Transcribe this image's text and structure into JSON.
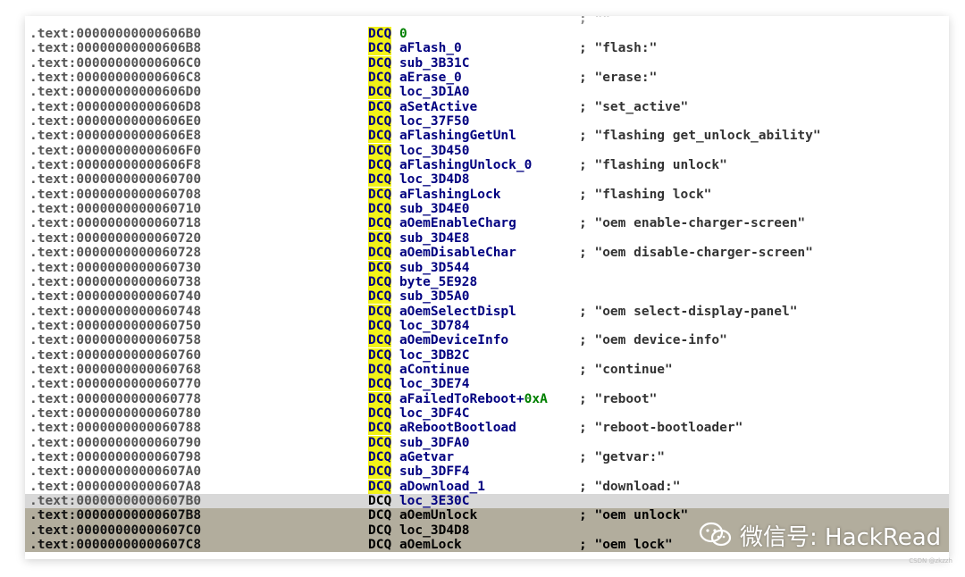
{
  "top_comment": "; \"\"",
  "rows": [
    {
      "addr": ".text:00000000000606B0",
      "kw": "DCQ",
      "op": "",
      "num": "0",
      "cmt": "",
      "hl": ""
    },
    {
      "addr": ".text:00000000000606B8",
      "kw": "DCQ",
      "op": "aFlash_0",
      "num": "",
      "cmt": "; \"flash:\"",
      "hl": ""
    },
    {
      "addr": ".text:00000000000606C0",
      "kw": "DCQ",
      "op": "sub_3B31C",
      "num": "",
      "cmt": "",
      "hl": ""
    },
    {
      "addr": ".text:00000000000606C8",
      "kw": "DCQ",
      "op": "aErase_0",
      "num": "",
      "cmt": "; \"erase:\"",
      "hl": ""
    },
    {
      "addr": ".text:00000000000606D0",
      "kw": "DCQ",
      "op": "loc_3D1A0",
      "num": "",
      "cmt": "",
      "hl": ""
    },
    {
      "addr": ".text:00000000000606D8",
      "kw": "DCQ",
      "op": "aSetActive",
      "num": "",
      "cmt": "; \"set_active\"",
      "hl": ""
    },
    {
      "addr": ".text:00000000000606E0",
      "kw": "DCQ",
      "op": "loc_37F50",
      "num": "",
      "cmt": "",
      "hl": ""
    },
    {
      "addr": ".text:00000000000606E8",
      "kw": "DCQ",
      "op": "aFlashingGetUnl",
      "num": "",
      "cmt": "; \"flashing get_unlock_ability\"",
      "hl": ""
    },
    {
      "addr": ".text:00000000000606F0",
      "kw": "DCQ",
      "op": "loc_3D450",
      "num": "",
      "cmt": "",
      "hl": ""
    },
    {
      "addr": ".text:00000000000606F8",
      "kw": "DCQ",
      "op": "aFlashingUnlock_0",
      "num": "",
      "cmt": "; \"flashing unlock\"",
      "hl": ""
    },
    {
      "addr": ".text:0000000000060700",
      "kw": "DCQ",
      "op": "loc_3D4D8",
      "num": "",
      "cmt": "",
      "hl": ""
    },
    {
      "addr": ".text:0000000000060708",
      "kw": "DCQ",
      "op": "aFlashingLock",
      "num": "",
      "cmt": "; \"flashing lock\"",
      "hl": ""
    },
    {
      "addr": ".text:0000000000060710",
      "kw": "DCQ",
      "op": "sub_3D4E0",
      "num": "",
      "cmt": "",
      "hl": ""
    },
    {
      "addr": ".text:0000000000060718",
      "kw": "DCQ",
      "op": "aOemEnableCharg",
      "num": "",
      "cmt": "; \"oem enable-charger-screen\"",
      "hl": ""
    },
    {
      "addr": ".text:0000000000060720",
      "kw": "DCQ",
      "op": "sub_3D4E8",
      "num": "",
      "cmt": "",
      "hl": ""
    },
    {
      "addr": ".text:0000000000060728",
      "kw": "DCQ",
      "op": "aOemDisableChar",
      "num": "",
      "cmt": "; \"oem disable-charger-screen\"",
      "hl": ""
    },
    {
      "addr": ".text:0000000000060730",
      "kw": "DCQ",
      "op": "sub_3D544",
      "num": "",
      "cmt": "",
      "hl": ""
    },
    {
      "addr": ".text:0000000000060738",
      "kw": "DCQ",
      "op": "byte_5E928",
      "num": "",
      "cmt": "",
      "hl": ""
    },
    {
      "addr": ".text:0000000000060740",
      "kw": "DCQ",
      "op": "sub_3D5A0",
      "num": "",
      "cmt": "",
      "hl": ""
    },
    {
      "addr": ".text:0000000000060748",
      "kw": "DCQ",
      "op": "aOemSelectDispl",
      "num": "",
      "cmt": "; \"oem select-display-panel\"",
      "hl": ""
    },
    {
      "addr": ".text:0000000000060750",
      "kw": "DCQ",
      "op": "loc_3D784",
      "num": "",
      "cmt": "",
      "hl": ""
    },
    {
      "addr": ".text:0000000000060758",
      "kw": "DCQ",
      "op": "aOemDeviceInfo",
      "num": "",
      "cmt": "; \"oem device-info\"",
      "hl": ""
    },
    {
      "addr": ".text:0000000000060760",
      "kw": "DCQ",
      "op": "loc_3DB2C",
      "num": "",
      "cmt": "",
      "hl": ""
    },
    {
      "addr": ".text:0000000000060768",
      "kw": "DCQ",
      "op": "aContinue",
      "num": "",
      "cmt": "; \"continue\"",
      "hl": ""
    },
    {
      "addr": ".text:0000000000060770",
      "kw": "DCQ",
      "op": "loc_3DE74",
      "num": "",
      "cmt": "",
      "hl": ""
    },
    {
      "addr": ".text:0000000000060778",
      "kw": "DCQ",
      "op": "aFailedToReboot+",
      "num": "0xA",
      "cmt": "; \"reboot\"",
      "hl": ""
    },
    {
      "addr": ".text:0000000000060780",
      "kw": "DCQ",
      "op": "loc_3DF4C",
      "num": "",
      "cmt": "",
      "hl": ""
    },
    {
      "addr": ".text:0000000000060788",
      "kw": "DCQ",
      "op": "aRebootBootload",
      "num": "",
      "cmt": "; \"reboot-bootloader\"",
      "hl": ""
    },
    {
      "addr": ".text:0000000000060790",
      "kw": "DCQ",
      "op": "sub_3DFA0",
      "num": "",
      "cmt": "",
      "hl": ""
    },
    {
      "addr": ".text:0000000000060798",
      "kw": "DCQ",
      "op": "aGetvar",
      "num": "",
      "cmt": "; \"getvar:\"",
      "hl": ""
    },
    {
      "addr": ".text:00000000000607A0",
      "kw": "DCQ",
      "op": "sub_3DFF4",
      "num": "",
      "cmt": "",
      "hl": ""
    },
    {
      "addr": ".text:00000000000607A8",
      "kw": "DCQ",
      "op": "aDownload_1",
      "num": "",
      "cmt": "; \"download:\"",
      "hl": ""
    },
    {
      "addr": ".text:00000000000607B0",
      "kw": "DCQ",
      "op": "loc_3E30C",
      "num": "",
      "cmt": "",
      "hl": "hl-light"
    },
    {
      "addr": ".text:00000000000607B8",
      "kw": "DCQ",
      "op": "aOemUnlock",
      "num": "",
      "cmt": "; \"oem unlock\"",
      "hl": "hl-dark"
    },
    {
      "addr": ".text:00000000000607C0",
      "kw": "DCQ",
      "op": "loc_3D4D8",
      "num": "",
      "cmt": "",
      "hl": "hl-dark"
    },
    {
      "addr": ".text:00000000000607C8",
      "kw": "DCQ",
      "op": "aOemLock",
      "num": "",
      "cmt": "; \"oem lock\"",
      "hl": "hl-dark"
    }
  ],
  "watermark": {
    "icon": "wechat-icon",
    "text": "微信号: HackRead"
  },
  "credit": "CSDN @zkzzh"
}
